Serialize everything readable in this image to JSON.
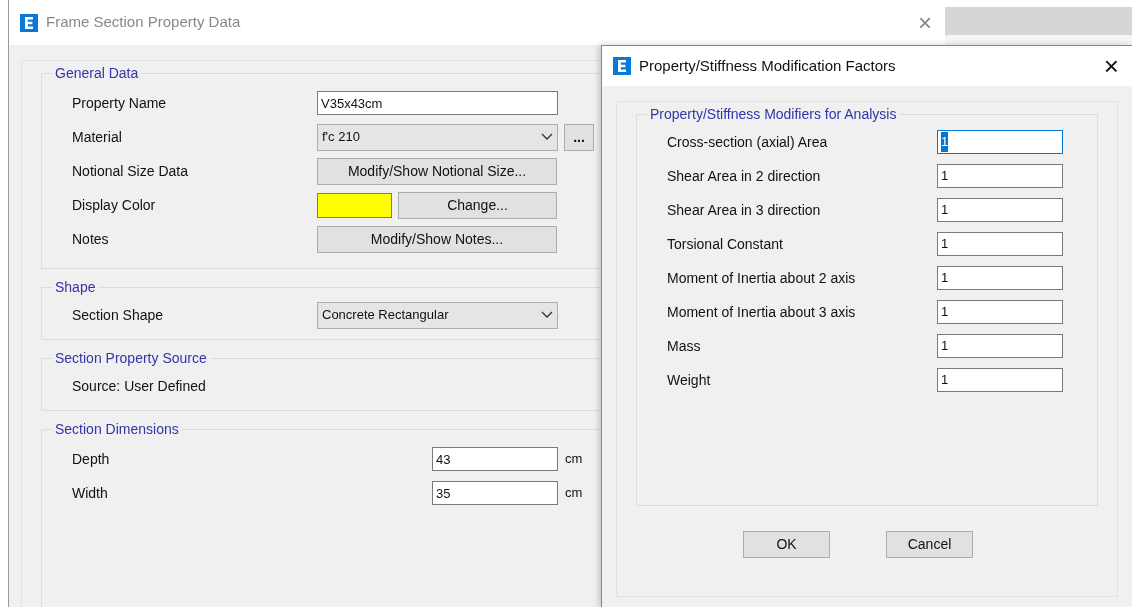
{
  "main_window": {
    "title": "Frame Section Property Data",
    "close": "×",
    "general_data": {
      "title": "General Data",
      "rows": [
        {
          "kind": "text",
          "label": "Property Name",
          "value": "V35x43cm"
        },
        {
          "kind": "dropdown",
          "label": "Material",
          "value": "f'c 210",
          "extra_button": "..."
        },
        {
          "kind": "button",
          "label": "Notional Size Data",
          "button": "Modify/Show Notional Size..."
        },
        {
          "kind": "color",
          "label": "Display Color",
          "color": "#ffff00",
          "button": "Change..."
        },
        {
          "kind": "button",
          "label": "Notes",
          "button": "Modify/Show Notes..."
        }
      ]
    },
    "shape": {
      "title": "Shape",
      "label": "Section Shape",
      "value": "Concrete Rectangular"
    },
    "source": {
      "title": "Section Property Source",
      "text": "Source:  User Defined"
    },
    "dimensions": {
      "title": "Section Dimensions",
      "rows": [
        {
          "label": "Depth",
          "value": "43",
          "unit": "cm"
        },
        {
          "label": "Width",
          "value": "35",
          "unit": "cm"
        }
      ]
    }
  },
  "modifiers_dialog": {
    "title": "Property/Stiffness Modification Factors",
    "close": "×",
    "group_title": "Property/Stiffness Modifiers for Analysis",
    "rows": [
      {
        "label": "Cross-section (axial) Area",
        "value": "1",
        "focused": true
      },
      {
        "label": "Shear Area in 2 direction",
        "value": "1",
        "focused": false
      },
      {
        "label": "Shear Area in 3 direction",
        "value": "1",
        "focused": false
      },
      {
        "label": "Torsional Constant",
        "value": "1",
        "focused": false
      },
      {
        "label": "Moment of Inertia about 2 axis",
        "value": "1",
        "focused": false
      },
      {
        "label": "Moment of Inertia about 3 axis",
        "value": "1",
        "focused": false
      },
      {
        "label": "Mass",
        "value": "1",
        "focused": false
      },
      {
        "label": "Weight",
        "value": "1",
        "focused": false
      }
    ],
    "buttons": [
      "OK",
      "Cancel"
    ]
  }
}
